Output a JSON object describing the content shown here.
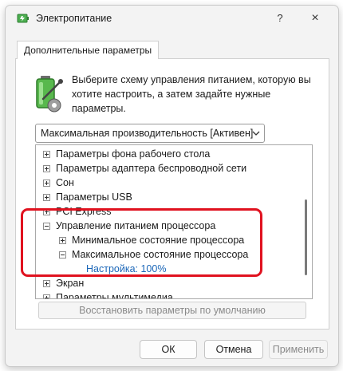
{
  "window": {
    "title": "Электропитание",
    "help": "?",
    "close": "×"
  },
  "tab": {
    "label": "Дополнительные параметры"
  },
  "description": "Выберите схему управления питанием, которую вы хотите настроить, а затем задайте нужные параметры.",
  "plan_select": {
    "value": "Максимальная производительность [Активен]"
  },
  "tree": {
    "items": [
      {
        "label": "Параметры фона рабочего стола",
        "state": "collapsed"
      },
      {
        "label": "Параметры адаптера беспроводной сети",
        "state": "collapsed"
      },
      {
        "label": "Сон",
        "state": "collapsed"
      },
      {
        "label": "Параметры USB",
        "state": "collapsed"
      },
      {
        "label": "PCI Express",
        "state": "collapsed"
      },
      {
        "label": "Управление питанием процессора",
        "state": "expanded"
      },
      {
        "label": "Минимальное состояние процессора",
        "state": "collapsed"
      },
      {
        "label": "Максимальное состояние процессора",
        "state": "expanded"
      },
      {
        "label": "Настройка: 100%",
        "state": "leaf"
      },
      {
        "label": "Экран",
        "state": "collapsed"
      },
      {
        "label": "Параметры мультимедиа",
        "state": "collapsed"
      }
    ]
  },
  "buttons": {
    "restore": "Восстановить параметры по умолчанию",
    "ok": "ОК",
    "cancel": "Отмена",
    "apply": "Применить"
  },
  "colors": {
    "highlight": "#e0121f",
    "value_text": "#1a66b8"
  }
}
